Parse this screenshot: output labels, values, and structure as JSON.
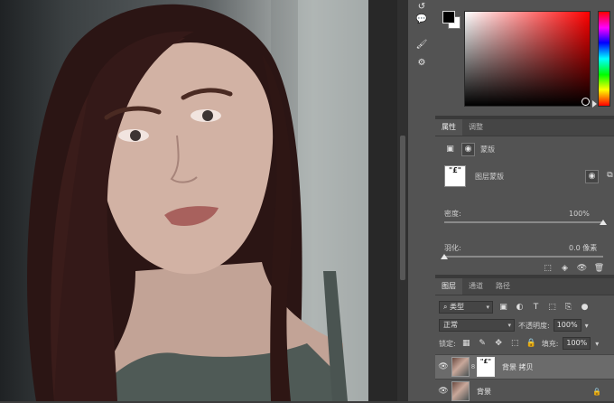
{
  "color_panel": {
    "foreground": "#000000",
    "background": "#ffffff",
    "hue": "#ff0000"
  },
  "properties_panel": {
    "tabs": [
      "属性",
      "调整"
    ],
    "active_tab": "属性",
    "type_label": "蒙版",
    "layer_mask_label": "图层蒙版",
    "density_label": "密度:",
    "density_value": "100%",
    "density_fraction": 1.0,
    "feather_label": "羽化:",
    "feather_value": "0.0 像素",
    "feather_fraction": 0.0
  },
  "layers_panel": {
    "tabs": [
      "图层",
      "通道",
      "路径"
    ],
    "active_tab": "图层",
    "filter_kind": "类型",
    "blend_mode": "正常",
    "opacity_label": "不透明度:",
    "opacity_value": "100%",
    "lock_label": "锁定:",
    "fill_label": "填充:",
    "fill_value": "100%",
    "layers": [
      {
        "name": "背景 拷贝",
        "selected": true,
        "has_mask": true,
        "locked": false
      },
      {
        "name": "背景",
        "selected": false,
        "has_mask": false,
        "locked": true
      }
    ]
  },
  "icons": {
    "mask_glyph": "\"£\""
  }
}
